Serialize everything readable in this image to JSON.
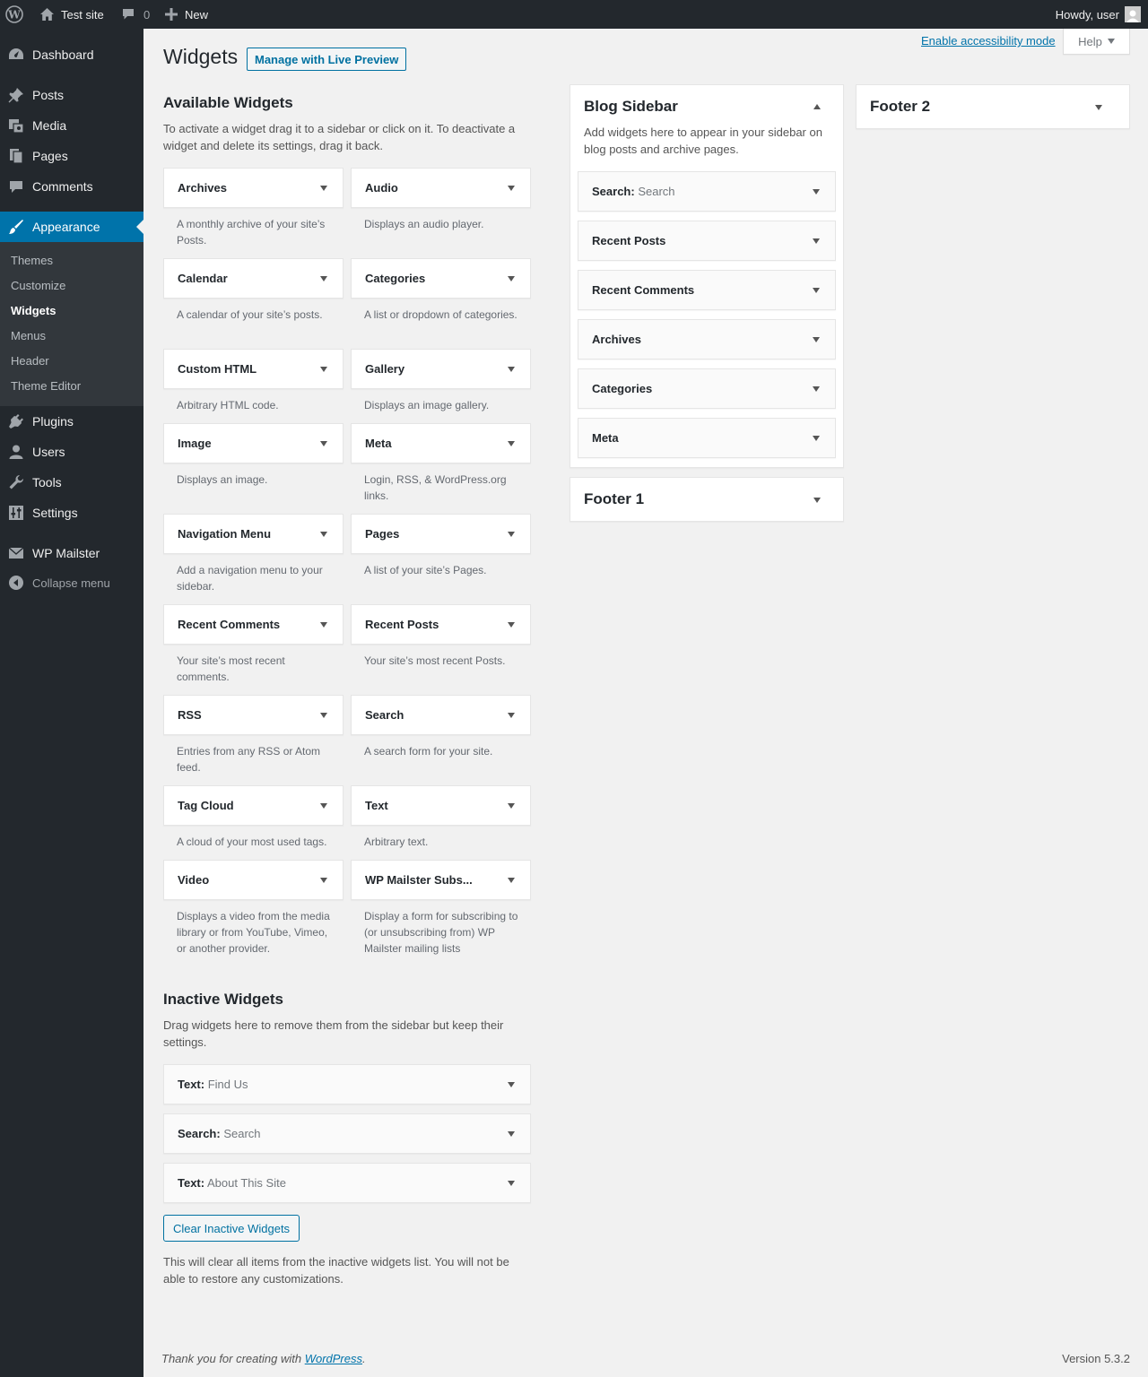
{
  "adminbar": {
    "site_name": "Test site",
    "comments_count": "0",
    "new_label": "New",
    "howdy": "Howdy, user"
  },
  "menu": {
    "dashboard": "Dashboard",
    "posts": "Posts",
    "media": "Media",
    "pages": "Pages",
    "comments": "Comments",
    "appearance": "Appearance",
    "plugins": "Plugins",
    "users": "Users",
    "tools": "Tools",
    "settings": "Settings",
    "mailster": "WP Mailster",
    "collapse": "Collapse menu",
    "submenu": [
      "Themes",
      "Customize",
      "Widgets",
      "Menus",
      "Header",
      "Theme Editor"
    ]
  },
  "page": {
    "title": "Widgets",
    "live_preview": "Manage with Live Preview",
    "accessibility_link": "Enable accessibility mode",
    "help": "Help"
  },
  "available": {
    "title": "Available Widgets",
    "description": "To activate a widget drag it to a sidebar or click on it. To deactivate a widget and delete its settings, drag it back.",
    "widgets": [
      {
        "name": "Archives",
        "desc": "A monthly archive of your site’s Posts."
      },
      {
        "name": "Audio",
        "desc": "Displays an audio player."
      },
      {
        "name": "Calendar",
        "desc": "A calendar of your site’s posts."
      },
      {
        "name": "Categories",
        "desc": "A list or dropdown of categories."
      },
      {
        "name": "Custom HTML",
        "desc": "Arbitrary HTML code."
      },
      {
        "name": "Gallery",
        "desc": "Displays an image gallery."
      },
      {
        "name": "Image",
        "desc": "Displays an image."
      },
      {
        "name": "Meta",
        "desc": "Login, RSS, & WordPress.org links."
      },
      {
        "name": "Navigation Menu",
        "desc": "Add a navigation menu to your sidebar."
      },
      {
        "name": "Pages",
        "desc": "A list of your site’s Pages."
      },
      {
        "name": "Recent Comments",
        "desc": "Your site’s most recent comments."
      },
      {
        "name": "Recent Posts",
        "desc": "Your site’s most recent Posts."
      },
      {
        "name": "RSS",
        "desc": "Entries from any RSS or Atom feed."
      },
      {
        "name": "Search",
        "desc": "A search form for your site."
      },
      {
        "name": "Tag Cloud",
        "desc": "A cloud of your most used tags."
      },
      {
        "name": "Text",
        "desc": "Arbitrary text."
      },
      {
        "name": "Video",
        "desc": "Displays a video from the media library or from YouTube, Vimeo, or another provider."
      },
      {
        "name": "WP Mailster Subs...",
        "desc": "Display a form for subscribing to (or unsubscribing from) WP Mailster mailing lists"
      }
    ]
  },
  "inactive": {
    "title": "Inactive Widgets",
    "description": "Drag widgets here to remove them from the sidebar but keep their settings.",
    "widgets": [
      {
        "name": "Text:",
        "instance": "Find Us"
      },
      {
        "name": "Search:",
        "instance": "Search"
      },
      {
        "name": "Text:",
        "instance": "About This Site"
      }
    ],
    "clear_button": "Clear Inactive Widgets",
    "clear_note": "This will clear all items from the inactive widgets list. You will not be able to restore any customizations."
  },
  "blog_sidebar": {
    "title": "Blog Sidebar",
    "description": "Add widgets here to appear in your sidebar on blog posts and archive pages.",
    "widgets": [
      {
        "name": "Search:",
        "instance": "Search"
      },
      {
        "name": "Recent Posts",
        "instance": ""
      },
      {
        "name": "Recent Comments",
        "instance": ""
      },
      {
        "name": "Archives",
        "instance": ""
      },
      {
        "name": "Categories",
        "instance": ""
      },
      {
        "name": "Meta",
        "instance": ""
      }
    ]
  },
  "footer1": {
    "title": "Footer 1"
  },
  "footer2": {
    "title": "Footer 2"
  },
  "footer": {
    "thanks_prefix": "Thank you for creating with",
    "wordpress_link": "WordPress",
    "thanks_suffix": ".",
    "version": "Version 5.3.2"
  }
}
